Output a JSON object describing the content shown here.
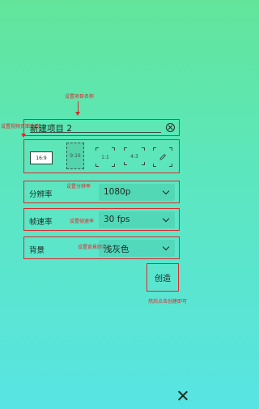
{
  "project": {
    "name": "新建项目 2"
  },
  "ratios": [
    "16:9",
    "9:16",
    "1:1",
    "4:3"
  ],
  "settings": {
    "resolution": {
      "label": "分辨率",
      "value": "1080p"
    },
    "framerate": {
      "label": "帧速率",
      "value": "30 fps"
    },
    "background": {
      "label": "背景",
      "value": "浅灰色"
    }
  },
  "create_label": "创造",
  "annotations": {
    "name": "设置项目名称",
    "ratio": "设置视频页面比例",
    "resolution": "设置分辨率",
    "framerate": "设置帧速率",
    "background": "设置背景颜色",
    "create": "然后点击创建即可"
  },
  "colors": {
    "annotation": "#e0282e",
    "background_top": "#62e59a",
    "background_bottom": "#58e4e3"
  }
}
